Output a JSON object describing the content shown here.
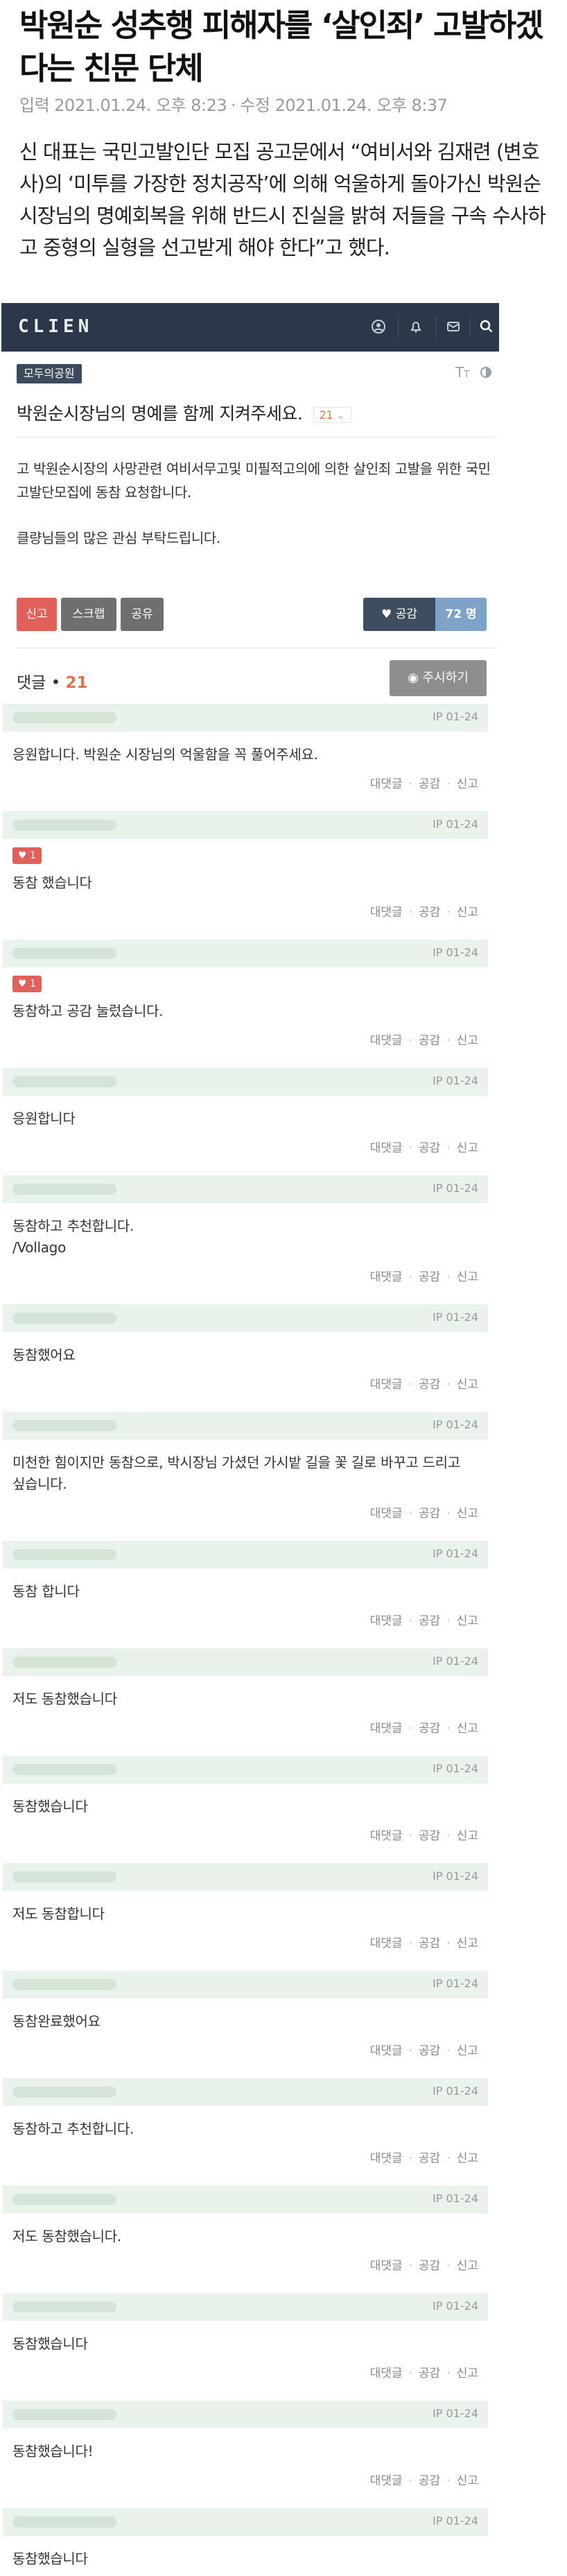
{
  "article": {
    "headline": "박원순 성추행 피해자를 ‘살인죄’ 고발하겠다는 친문 단체",
    "input_date": "입력 2021.01.24. 오후 8:23",
    "edit_date": "수정 2021.01.24. 오후 8:37",
    "quote": "신 대표는 국민고발인단 모집 공고문에서 “여비서와 김재련 (변호사)의 ‘미투를 가장한 정치공작’에 의해 억울하게 돌아가신 박원순 시장님의 명예회복을 위해 반드시 진실을 밝혀 저들을 구속 수사하고 중형의 실형을 선고받게 해야 한다”고 했다."
  },
  "site": {
    "logo": "CLIEN",
    "icons": [
      "user-icon",
      "bell-icon",
      "mail-icon",
      "search-icon"
    ]
  },
  "post": {
    "board": "모두의공원",
    "title": "박원순시장님의 명예를 함께 지켜주세요.",
    "comment_count": "21",
    "body_p1": "고 박원순시장의 사망관련 여비서무고및 미필적고의에 의한 살인죄 고발을 위한 국민고발단모집에 동참 요청합니다.",
    "body_p2": "클량님들의 많은 관심 부탁드립니다.",
    "buttons": {
      "report": "신고",
      "scrap": "스크랩",
      "share": "공유",
      "like": "공감",
      "like_count": "72 명"
    }
  },
  "comments_header": {
    "label": "댓글 •",
    "count": "21",
    "sort_button": "주시하기"
  },
  "comment_actions": {
    "reply": "대댓글",
    "like": "공감",
    "report": "신고"
  },
  "comments": [
    {
      "ip": "IP 01-24",
      "text": "응원합니다. 박원순 시장님의 억울함을 꼭 풀어주세요.",
      "likes": ""
    },
    {
      "ip": "IP 01-24",
      "text": "동참 했습니다",
      "likes": "1"
    },
    {
      "ip": "IP 01-24",
      "text": "동참하고 공감 눌렀습니다.",
      "likes": "1"
    },
    {
      "ip": "IP 01-24",
      "text": "응원합니다",
      "likes": ""
    },
    {
      "ip": "IP 01-24",
      "text": "동참하고 추천합니다.\n/Vollago",
      "likes": ""
    },
    {
      "ip": "IP 01-24",
      "text": "동참했어요",
      "likes": ""
    },
    {
      "ip": "IP 01-24",
      "text": "미천한 힘이지만 동참으로, 박시장님 가셨던 가시밭 길을 꽃 길로 바꾸고 드리고 싶습니다.",
      "likes": ""
    },
    {
      "ip": "IP 01-24",
      "text": "동참 합니다",
      "likes": ""
    },
    {
      "ip": "IP 01-24",
      "text": "저도 동참했습니다",
      "likes": ""
    },
    {
      "ip": "IP 01-24",
      "text": "동참했습니다",
      "likes": ""
    },
    {
      "ip": "IP 01-24",
      "text": "저도 동참합니다",
      "likes": ""
    },
    {
      "ip": "IP 01-24",
      "text": "동참완료했어요",
      "likes": ""
    },
    {
      "ip": "IP 01-24",
      "text": "동참하고 추천합니다.",
      "likes": ""
    },
    {
      "ip": "IP 01-24",
      "text": "저도 동참했습니다.",
      "likes": ""
    },
    {
      "ip": "IP 01-24",
      "text": "동참했습니다",
      "likes": ""
    },
    {
      "ip": "IP 01-24",
      "text": "동참했습니다!",
      "likes": ""
    },
    {
      "ip": "IP 01-24",
      "text": "동참했습니다",
      "likes": ""
    }
  ]
}
